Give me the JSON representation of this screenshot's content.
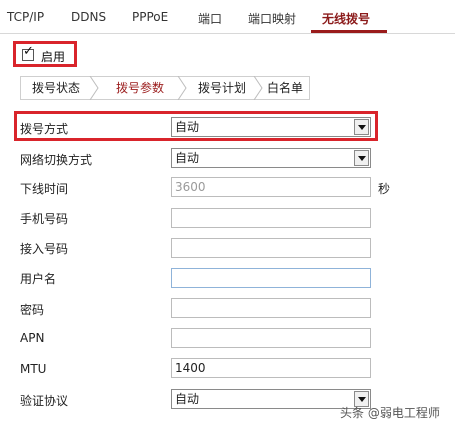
{
  "top_tabs": [
    {
      "label": "TCP/IP"
    },
    {
      "label": "DDNS"
    },
    {
      "label": "PPPoE"
    },
    {
      "label": "端口"
    },
    {
      "label": "端口映射"
    },
    {
      "label": "无线拨号"
    }
  ],
  "enable": {
    "label": "启用",
    "checked": true
  },
  "sub_tabs": [
    {
      "label": "拨号状态"
    },
    {
      "label": "拨号参数"
    },
    {
      "label": "拨号计划"
    },
    {
      "label": "白名单"
    }
  ],
  "form": {
    "dial_mode": {
      "label": "拨号方式",
      "value": "自动"
    },
    "network_switch": {
      "label": "网络切换方式",
      "value": "自动"
    },
    "offline_time": {
      "label": "下线时间",
      "value": "3600",
      "unit": "秒"
    },
    "phone_number": {
      "label": "手机号码",
      "value": ""
    },
    "access_number": {
      "label": "接入号码",
      "value": ""
    },
    "username": {
      "label": "用户名",
      "value": ""
    },
    "password": {
      "label": "密码",
      "value": ""
    },
    "apn": {
      "label": "APN",
      "value": ""
    },
    "mtu": {
      "label": "MTU",
      "value": "1400"
    },
    "auth_protocol": {
      "label": "验证协议",
      "value": "自动"
    }
  },
  "watermark": {
    "text": "头条 @弱电工程师"
  },
  "colors": {
    "accent": "#9a1b1b",
    "highlight": "#d9242b"
  }
}
